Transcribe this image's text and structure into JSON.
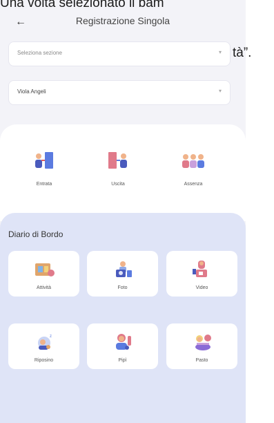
{
  "doc": {
    "line1": "Una volta selezionato il bam",
    "line2": "tà”."
  },
  "header": {
    "title": "Registrazione Singola"
  },
  "selects": {
    "section": "Seleziona sezione",
    "child": "Viola Angeli"
  },
  "actions": [
    {
      "label": "Entrata",
      "icon": "enter-door-icon"
    },
    {
      "label": "Uscita",
      "icon": "exit-door-icon"
    },
    {
      "label": "Assenza",
      "icon": "absence-icon"
    }
  ],
  "diary": {
    "title": "Diario di Bordo",
    "tiles": [
      {
        "label": "Attività",
        "icon": "activity-icon"
      },
      {
        "label": "Foto",
        "icon": "photo-icon"
      },
      {
        "label": "Video",
        "icon": "video-icon"
      },
      {
        "label": "Riposino",
        "icon": "nap-icon"
      },
      {
        "label": "Pipì",
        "icon": "potty-icon"
      },
      {
        "label": "Pasto",
        "icon": "meal-icon"
      }
    ]
  },
  "colors": {
    "accent": "#dfe4f7",
    "background": "#f3f3f8"
  }
}
